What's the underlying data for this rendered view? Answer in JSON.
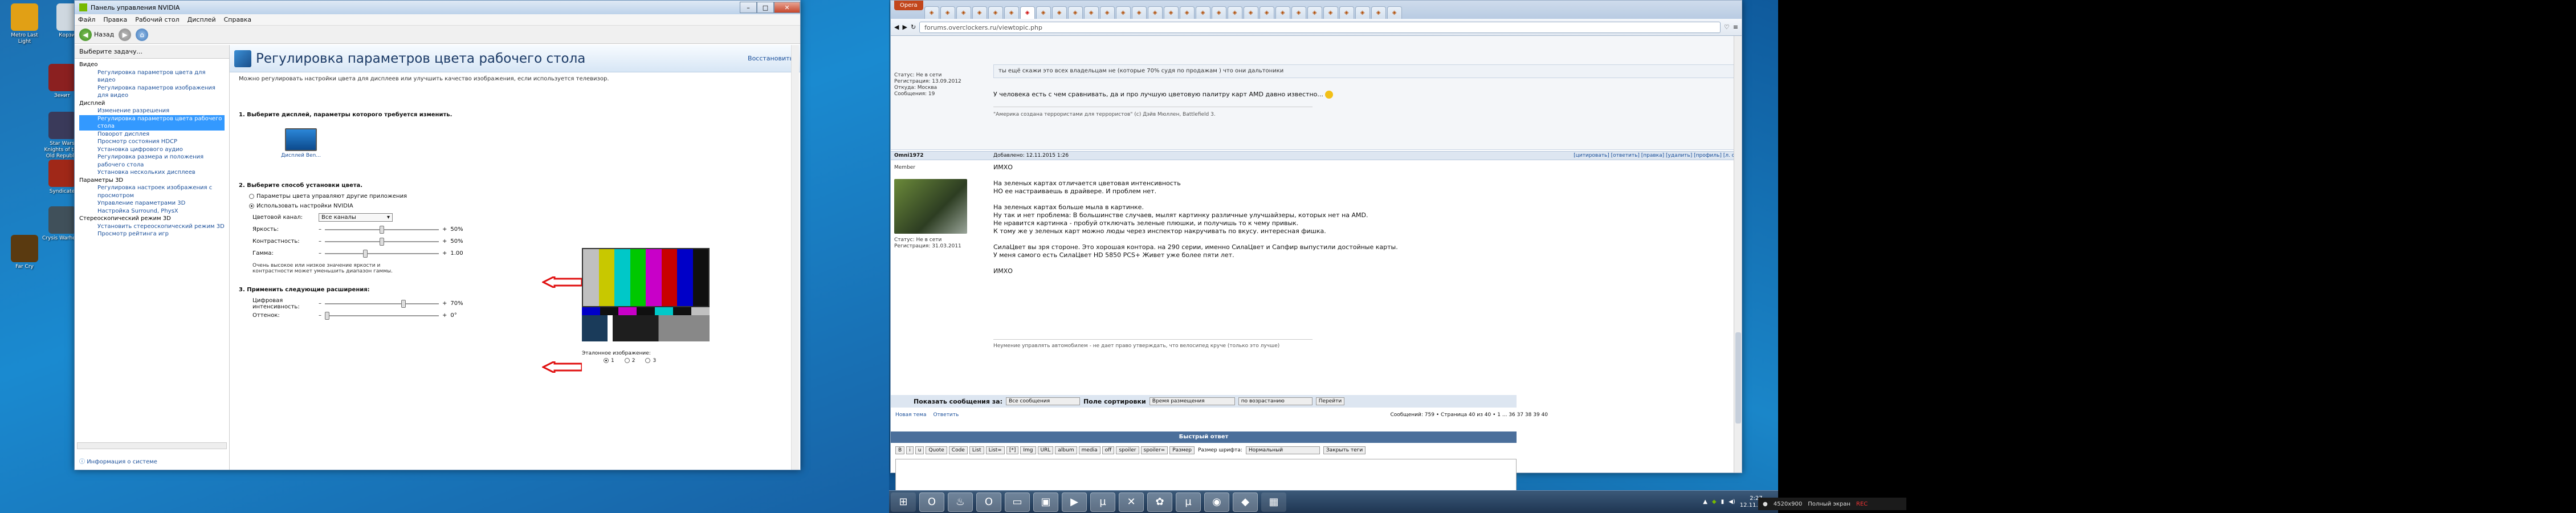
{
  "desktop": {
    "icons": [
      {
        "label": "Metro Last Light",
        "icon": "metro-icon",
        "color": "#e1a015"
      },
      {
        "label": "Корзина",
        "icon": "recycle-bin-icon",
        "color": "#cfd8e0"
      },
      {
        "label": "Зенит",
        "icon": "game-icon",
        "color": "#8b2020"
      },
      {
        "label": "Star Wars Knights of the Old Republic",
        "icon": "game-icon",
        "color": "#3a3a5a"
      },
      {
        "label": "Syndicate",
        "icon": "game-icon",
        "color": "#a02818"
      },
      {
        "label": "Crysis Warhead",
        "icon": "game-icon",
        "color": "#40505a"
      },
      {
        "label": "Far Cry",
        "icon": "game-icon",
        "color": "#5a3a10"
      }
    ]
  },
  "nvidia": {
    "title": "Панель управления NVIDIA",
    "menu": [
      "Файл",
      "Правка",
      "Рабочий стол",
      "Дисплей",
      "Справка"
    ],
    "back_label": "Назад",
    "sidebar_head": "Выберите задачу...",
    "tree": [
      {
        "text": "Видео",
        "type": "cat"
      },
      {
        "text": "Регулировка параметров цвета для видео",
        "type": "item"
      },
      {
        "text": "Регулировка параметров изображения для видео",
        "type": "item"
      },
      {
        "text": "Дисплей",
        "type": "cat"
      },
      {
        "text": "Изменение разрешения",
        "type": "item"
      },
      {
        "text": "Регулировка параметров цвета рабочего стола",
        "type": "item",
        "selected": true
      },
      {
        "text": "Поворот дисплея",
        "type": "item"
      },
      {
        "text": "Просмотр состояния HDCP",
        "type": "item"
      },
      {
        "text": "Установка цифрового аудио",
        "type": "item"
      },
      {
        "text": "Регулировка размера и положения рабочего стола",
        "type": "item"
      },
      {
        "text": "Установка нескольких дисплеев",
        "type": "item"
      },
      {
        "text": "Параметры 3D",
        "type": "cat"
      },
      {
        "text": "Регулировка настроек изображения с просмотром",
        "type": "item"
      },
      {
        "text": "Управление параметрами 3D",
        "type": "item"
      },
      {
        "text": "Настройка Surround, PhysX",
        "type": "item"
      },
      {
        "text": "Стереоскопический режим 3D",
        "type": "cat"
      },
      {
        "text": "Установить стереоскопический режим 3D",
        "type": "item"
      },
      {
        "text": "Просмотр рейтинга игр",
        "type": "item"
      }
    ],
    "sysinfo": "Информация о системе",
    "page_title": "Регулировка параметров цвета рабочего стола",
    "restore": "Восстановить",
    "desc": "Можно регулировать настройки цвета для дисплеев или улучшить качество изображения, если используется телевизор.",
    "step1": "1. Выберите дисплей, параметры которого требуется изменить.",
    "display_label": "Дисплей Ben...",
    "step2": "2. Выберите способ установки цвета.",
    "opt_other": "Параметры цвета управляют другие приложения",
    "opt_nvidia": "Использовать настройки NVIDIA",
    "channel_label": "Цветовой канал:",
    "channel_value": "Все каналы",
    "brightness_label": "Яркость:",
    "brightness_val": "50%",
    "brightness": 0.5,
    "contrast_label": "Контрастность:",
    "contrast_val": "50%",
    "contrast": 0.5,
    "gamma_label": "Гамма:",
    "gamma_val": "1.00",
    "gamma": 0.35,
    "note": "Очень высокое или низкое значение яркости и контрастности может уменьшить диапазон гаммы.",
    "step3": "3. Применить следующие расширения:",
    "vibrance_label": "Цифровая интенсивность:",
    "vibrance_val": "70%",
    "vibrance": 0.7,
    "hue_label": "Оттенок:",
    "hue_val": "0°",
    "hue": 0.0,
    "ref_label": "Эталонное изображение:",
    "ref_opts": [
      "1",
      "2",
      "3"
    ],
    "bar_colors": [
      "#c0c0c0",
      "#c8c800",
      "#00c8c8",
      "#00c800",
      "#c800c8",
      "#c80000",
      "#0000c8",
      "#101010"
    ],
    "low_colors": [
      "#0000c8",
      "#101010",
      "#c800c8",
      "#101010",
      "#00c8c8",
      "#101010",
      "#c0c0c0"
    ],
    "arrow_color": "#e01010"
  },
  "firefox": {
    "menu_label": "Opera",
    "url": "forums.overclockers.ru/viewtopic.php",
    "tab_count": 30,
    "active_tab": 6,
    "top_quote": "ты ещё скажи это всех владельцам не (которые 70% судя по продажам ) что они дальтоники",
    "top_reply": "У человека есть с чем сравнивать, да и про лучшую цветовую палитру карт AMD давно известно...",
    "top_user": [
      "Статус: Не в сети",
      "Регистрация: 13.09.2012",
      "Откуда: Москва",
      "Сообщения: 19"
    ],
    "top_sig": "\"Америка создана террористами для террористов\" (с) Дэйв Мюллен, Battlefield 3.",
    "post_user": "Omni1972",
    "post_role": "Member",
    "post_stats": [
      "Статус: Не в сети",
      "Регистрация: 31.03.2011"
    ],
    "post_meta": "Добавлено: 12.11.2015 1:26",
    "post_tools": "[цитировать] [ответить] [правка] [удалить] [профиль] [л. с.]",
    "post_lines": [
      "ИМХО",
      "",
      "На зеленых картах отличается цветовая интенсивность",
      "НО ее настраиваешь в драйвере. И проблем нет.",
      "",
      "На зеленых картах больше мыла в картинке.",
      "Ну так и нет проблема: В большинстве случаев, мылят картинку различные улучшайзеры, которых нет на AMD.",
      "Не нравится картинка - пробуй отключать зеленые плюшки, и получишь то к чему привык.",
      "К тому же у зеленых карт можно люды через инспектор накручивать по вкусу. интересная фишка.",
      "",
      "СилаЦвет вы зря стороне. Это хорошая контора. на 290 серии, именно СилаЦвет и Сапфир выпустили достойные карты.",
      "У меня самого есть СилаЦвет HD 5850 PCS+ Живет уже более пяти лет.",
      "",
      "ИМХО"
    ],
    "post_sig": "Неумение управлять автомобилем - не дает право утверждать, что велосипед круче (только это лучше)",
    "show_label": "Показать сообщения за:",
    "show_value": "Все сообщения",
    "sort_label": "Поле сортировки",
    "sort_value": "Время размещения",
    "order_value": "по возрастанию",
    "go_label": "Перейти",
    "new_topic": "Новая тема",
    "reply": "Ответить",
    "pages": "Сообщений: 759 • Страница 40 из 40 • 1 ... 36 37 38 39 40",
    "quick_reply": "Быстрый ответ",
    "fmt_buttons": [
      "B",
      "i",
      "u",
      "Quote",
      "Code",
      "List",
      "List=",
      "[*]",
      "Img",
      "URL",
      "album",
      "media",
      "off",
      "spoiler",
      "spoiler=",
      "Размер"
    ],
    "font_label": "Размер шрифта:",
    "font_value": "Нормальный",
    "close_tags": "Закрыть теги"
  },
  "taskbar": {
    "icons": [
      {
        "name": "windows-start-icon",
        "glyph": "⊞"
      },
      {
        "name": "opera-icon",
        "glyph": "O"
      },
      {
        "name": "steam-icon",
        "glyph": "♨"
      },
      {
        "name": "opera-icon",
        "glyph": "O"
      },
      {
        "name": "folder-icon",
        "glyph": "▭"
      },
      {
        "name": "app-icon",
        "glyph": "▣"
      },
      {
        "name": "winamp-icon",
        "glyph": "▶"
      },
      {
        "name": "utorrent-icon",
        "glyph": "µ"
      },
      {
        "name": "app-icon",
        "glyph": "✕"
      },
      {
        "name": "speedfan-icon",
        "glyph": "✿"
      },
      {
        "name": "utorrent-icon",
        "glyph": "µ"
      },
      {
        "name": "app-icon",
        "glyph": "◉"
      },
      {
        "name": "nvidia-icon",
        "glyph": "◆"
      },
      {
        "name": "app-icon",
        "glyph": "▦"
      }
    ],
    "time": "2:27",
    "date": "12.11.2015"
  },
  "capture": {
    "res": "4520x900",
    "mode": "Полный экран",
    "rec": "REC"
  }
}
